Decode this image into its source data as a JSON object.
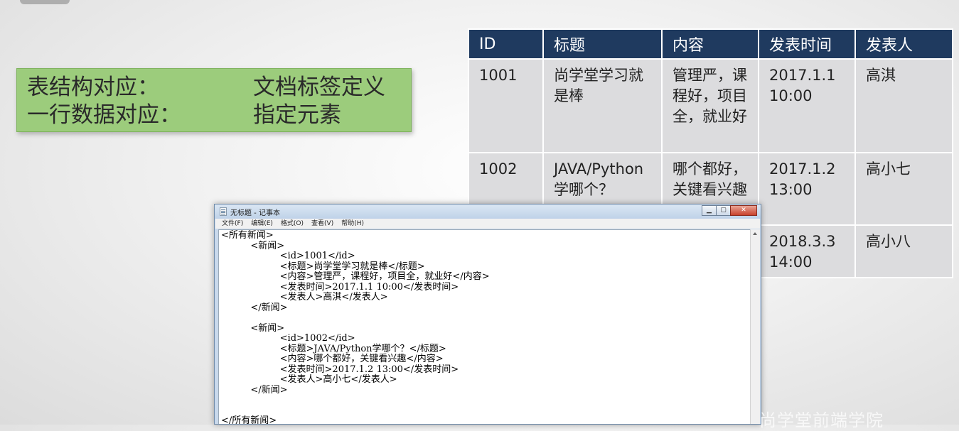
{
  "definition": {
    "rows": [
      {
        "key": "表结构对应：",
        "value": "文档标签定义"
      },
      {
        "key": "一行数据对应：",
        "value": "指定元素"
      }
    ]
  },
  "table": {
    "headers": [
      "ID",
      "标题",
      "内容",
      "发表时间",
      "发表人"
    ],
    "rows": [
      {
        "id": "1001",
        "title": "尚学堂学习就是棒",
        "content": "管理严，课程好，项目全，就业好",
        "time": "2017.1.1 10:00",
        "author": "高淇"
      },
      {
        "id": "1002",
        "title": "JAVA/Python学哪个？",
        "content": "哪个都好，关键看兴趣",
        "time": "2017.1.2 13:00",
        "author": "高小七"
      },
      {
        "id": "",
        "title": "",
        "content": "",
        "time": "2018.3.3 14:00",
        "author": "高小八"
      }
    ]
  },
  "notepad": {
    "title": "无标题 - 记事本",
    "menu": [
      "文件(F)",
      "编辑(E)",
      "格式(O)",
      "查看(V)",
      "帮助(H)"
    ],
    "lines": [
      "<所有新闻>",
      "          <新闻>",
      "                    <id>1001</id>",
      "                    <标题>尚学堂学习就是棒</标题>",
      "                    <内容>管理严，课程好，项目全，就业好</内容>",
      "                    <发表时间>2017.1.1 10:00</发表时间>",
      "                    <发表人>高淇</发表人>",
      "          </新闻>",
      "",
      "          <新闻>",
      "                    <id>1002</id>",
      "                    <标题>JAVA/Python学哪个？</标题>",
      "                    <内容>哪个都好，关键看兴趣</内容>",
      "                    <发表时间>2017.1.2 13:00</发表时间>",
      "                    <发表人>高小七</发表人>",
      "          </新闻>",
      "",
      "",
      "</所有新闻>"
    ]
  },
  "watermark": "尚学堂前端学院"
}
